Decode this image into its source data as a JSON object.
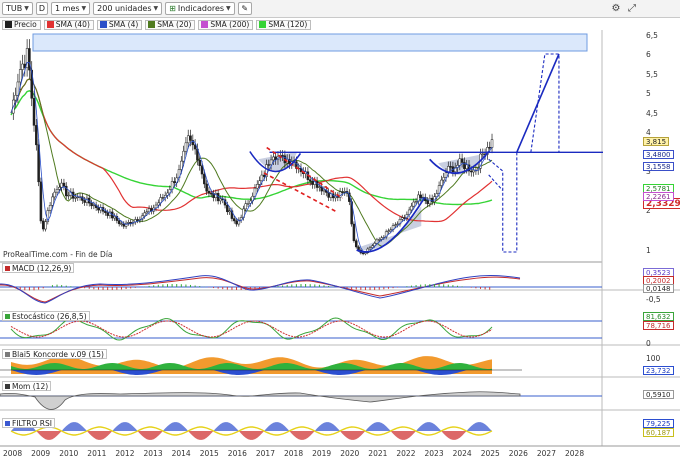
{
  "toolbar": {
    "symbol": "TUB",
    "chart_type": "D",
    "period": "1 mes",
    "units": "200 unidades",
    "indicators": "Indicadores"
  },
  "legend": [
    {
      "label": "Precio",
      "color": "#1f1f1f"
    },
    {
      "label": "SMA (40)",
      "color": "#e13232"
    },
    {
      "label": "SMA (4)",
      "color": "#2a4fc8"
    },
    {
      "label": "SMA (20)",
      "color": "#4f7a1f"
    },
    {
      "label": "SMA (200)",
      "color": "#c44fd0"
    },
    {
      "label": "SMA (120)",
      "color": "#36d436"
    }
  ],
  "price_axis": [
    "6,5",
    "6",
    "5,5",
    "5",
    "4,5",
    "4",
    "3",
    "2",
    "1"
  ],
  "price_tags": {
    "last": "3,815",
    "resistance": "3,4800",
    "sma4": "3,1558",
    "sma120": "2,5781",
    "sma40": "2,3329",
    "sma200": "2,2261"
  },
  "footnote": "ProRealTime.com - Fin de Día",
  "panels": {
    "macd": {
      "label": "MACD (12,26,9)",
      "values": [
        "0,3523",
        "0,2002",
        "0,0148",
        "-0,5"
      ]
    },
    "stoch": {
      "label": "Estocástico (26,8,5)",
      "values": [
        "81,632",
        "78,716",
        "0"
      ]
    },
    "koncorde": {
      "label": "Blai5 Koncorde v.09 (15)",
      "values": [
        "100",
        "23,732"
      ]
    },
    "mom": {
      "label": "Mom (12)",
      "values": [
        "0,5910"
      ]
    },
    "rsi": {
      "label": "FILTRO RSI",
      "values": [
        "79,225",
        "60,187"
      ]
    }
  },
  "x_axis": [
    "2008",
    "2009",
    "2010",
    "2011",
    "2012",
    "2013",
    "2014",
    "2015",
    "2016",
    "2017",
    "2018",
    "2019",
    "2020",
    "2021",
    "2022",
    "2023",
    "2024",
    "2025",
    "2026",
    "2027",
    "2028"
  ],
  "chart_data": {
    "type": "line",
    "x": [
      2008.0,
      2008.3,
      2008.6,
      2008.9,
      2009.1,
      2009.4,
      2009.7,
      2010.0,
      2010.5,
      2011.0,
      2011.5,
      2012.0,
      2012.5,
      2013.0,
      2013.5,
      2014.0,
      2014.3,
      2014.6,
      2015.0,
      2015.5,
      2016.0,
      2016.5,
      2017.0,
      2017.3,
      2017.6,
      2018.0,
      2018.5,
      2019.0,
      2019.5,
      2020.0,
      2020.2,
      2020.5,
      2021.0,
      2021.5,
      2022.0,
      2022.5,
      2023.0,
      2023.5,
      2024.0,
      2024.5,
      2024.9,
      2025.2
    ],
    "series": [
      {
        "name": "Precio",
        "values": [
          4.5,
          5.6,
          6.0,
          3.6,
          1.4,
          2.2,
          2.7,
          2.4,
          2.3,
          2.1,
          1.9,
          1.6,
          1.8,
          2.0,
          2.4,
          3.0,
          3.8,
          3.5,
          2.4,
          2.3,
          1.6,
          2.3,
          2.9,
          3.5,
          3.3,
          3.3,
          2.9,
          2.6,
          2.3,
          2.5,
          1.2,
          0.9,
          1.2,
          1.5,
          1.8,
          2.3,
          2.2,
          3.0,
          3.2,
          3.0,
          3.6,
          3.815
        ]
      }
    ],
    "ylim": [
      0.8,
      6.6
    ]
  }
}
